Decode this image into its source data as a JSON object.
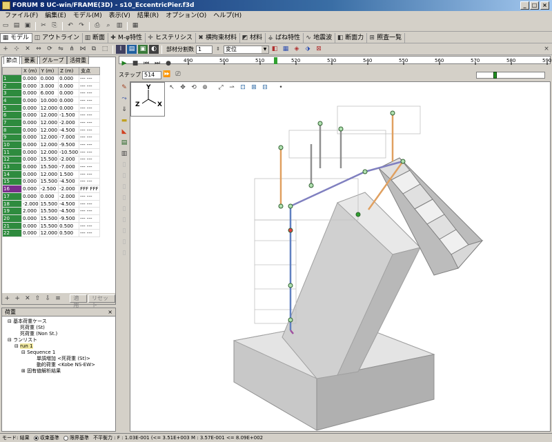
{
  "window": {
    "title": "FORUM 8 UC-win/FRAME(3D) - s10_EccentricPier.f3d"
  },
  "menu": [
    "ファイル(F)",
    "編集(E)",
    "モデル(M)",
    "表示(V)",
    "結果(R)",
    "オプション(O)",
    "ヘルプ(H)"
  ],
  "tabs": [
    {
      "label": "モデル",
      "icon": "model-icon"
    },
    {
      "label": "アウトライン",
      "icon": "outline-icon"
    },
    {
      "label": "断面",
      "icon": "section-icon"
    },
    {
      "label": "M-φ特性",
      "icon": "m-phi-icon"
    },
    {
      "label": "ヒステリシス",
      "icon": "hysteresis-icon"
    },
    {
      "label": "横拘束材料",
      "icon": "confinement-icon"
    },
    {
      "label": "材料",
      "icon": "material-icon"
    },
    {
      "label": "ばね特性",
      "icon": "spring-icon"
    },
    {
      "label": "地震波",
      "icon": "wave-icon"
    },
    {
      "label": "断面力",
      "icon": "force-icon"
    },
    {
      "label": "照査一覧",
      "icon": "check-icon"
    }
  ],
  "toolbar3": {
    "division_label": "部材分割数",
    "division_value": "1",
    "display_select": "変位"
  },
  "ruler": {
    "ticks": [
      "490",
      "500",
      "510",
      "520",
      "530",
      "540",
      "550",
      "560",
      "570",
      "580",
      "590"
    ]
  },
  "step": {
    "label": "ステップ",
    "value": "514"
  },
  "grid": {
    "tabs": [
      "節点",
      "要素",
      "グループ",
      "活荷重"
    ],
    "headers": [
      "",
      "X (m)",
      "Y (m)",
      "Z (m)",
      "支点"
    ],
    "rows": [
      [
        "1",
        "0.000",
        "0.000",
        "0.000",
        "--- ---"
      ],
      [
        "2",
        "0.000",
        "3.000",
        "0.000",
        "--- ---"
      ],
      [
        "3",
        "0.000",
        "6.000",
        "0.000",
        "--- ---"
      ],
      [
        "4",
        "0.000",
        "10.000",
        "0.000",
        "--- ---"
      ],
      [
        "5",
        "0.000",
        "12.000",
        "0.000",
        "--- ---"
      ],
      [
        "6",
        "0.000",
        "12.000",
        "-1.500",
        "--- ---"
      ],
      [
        "7",
        "0.000",
        "12.000",
        "-2.000",
        "--- ---"
      ],
      [
        "8",
        "0.000",
        "12.000",
        "-4.500",
        "--- ---"
      ],
      [
        "9",
        "0.000",
        "12.000",
        "-7.000",
        "--- ---"
      ],
      [
        "10",
        "0.000",
        "12.000",
        "-9.500",
        "--- ---"
      ],
      [
        "11",
        "0.000",
        "12.000",
        "-10.500",
        "--- ---"
      ],
      [
        "12",
        "0.000",
        "15.500",
        "-2.000",
        "--- ---"
      ],
      [
        "13",
        "0.000",
        "15.500",
        "-7.000",
        "--- ---"
      ],
      [
        "14",
        "0.000",
        "12.000",
        "1.500",
        "--- ---"
      ],
      [
        "15",
        "0.000",
        "15.500",
        "-4.500",
        "--- ---"
      ],
      [
        "16",
        "0.000",
        "-2.500",
        "-2.000",
        "FFF FFF"
      ],
      [
        "17",
        "0.000",
        "0.000",
        "-2.000",
        "--- ---"
      ],
      [
        "18",
        "-2.000",
        "15.500",
        "-4.500",
        "--- ---"
      ],
      [
        "19",
        "2.000",
        "15.500",
        "-4.500",
        "--- ---"
      ],
      [
        "20",
        "0.000",
        "15.500",
        "-9.500",
        "--- ---"
      ],
      [
        "21",
        "0.000",
        "15.500",
        "0.500",
        "--- ---"
      ],
      [
        "22",
        "0.000",
        "12.000",
        "0.500",
        "--- ---"
      ]
    ],
    "apply_label": "適用",
    "reset_label": "リセット"
  },
  "load": {
    "header": "荷重",
    "tree": [
      "基本荷重ケース",
      "死荷重 (St)",
      "死荷重 (Non St.)",
      "ランリスト",
      "run 1",
      "Sequence 1",
      "単調増加 <死荷重 (St)>",
      "動的荷重 <Kobe NS-EW>",
      "固有値解析結果"
    ]
  },
  "status": {
    "mode": "モード: 結果",
    "convergence": "収束基準",
    "limit": "限界基準",
    "imbalance": "不平衡力 : F : 1.03E-001 (<= 3.51E+003 M : 3.57E-001 <= 8.09E+002"
  },
  "axes": {
    "y": "Y",
    "z": "Z",
    "x": "X"
  }
}
